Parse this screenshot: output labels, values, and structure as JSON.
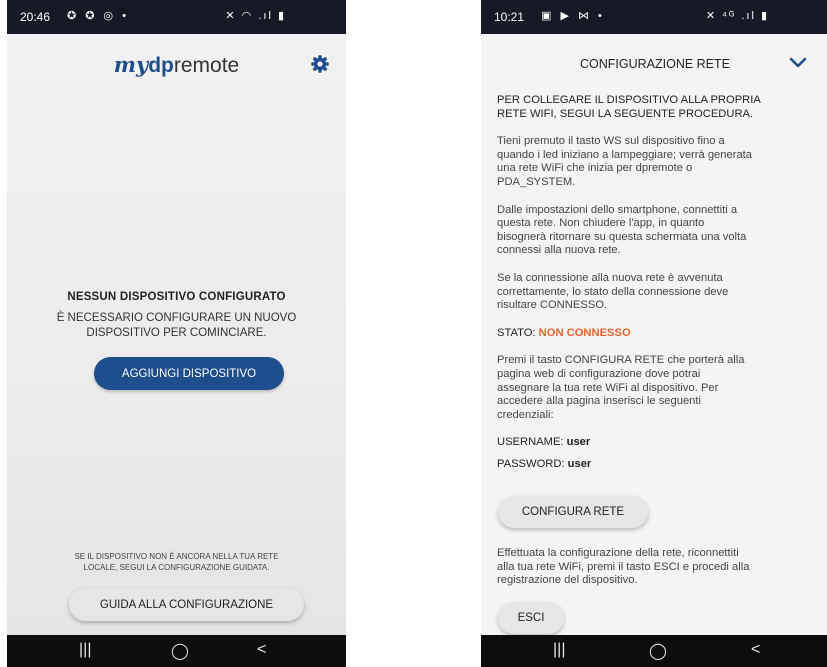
{
  "left_screen": {
    "status_bar": {
      "time": "20:46",
      "left_icons": "✪ ✪ ◎ •",
      "right_icons": "✕ ◠ .ıl ▮"
    },
    "app_logo": {
      "my": "my",
      "dp": "dp",
      "remote": "remote"
    },
    "empty_state": {
      "title": "NESSUN DISPOSITIVO CONFIGURATO",
      "line1": "È NECESSARIO CONFIGURARE UN NUOVO",
      "line2": "DISPOSITIVO PER COMINCIARE."
    },
    "add_device_button": "AGGIUNGI DISPOSITIVO",
    "hint": {
      "line1": "SE IL DISPOSITIVO NON È ANCORA NELLA TUA RETE",
      "line2": "LOCALE, SEGUI LA CONFIGURAZIONE GUIDATA."
    },
    "guide_button": "GUIDA ALLA CONFIGURAZIONE",
    "nav": {
      "recents": "|||",
      "home": "◯",
      "back": "<"
    }
  },
  "right_screen": {
    "status_bar": {
      "time": "10:21",
      "left_icons": "▣ ▶ ⋈ •",
      "right_icons": "✕ ⁴ᴳ .ıl ▮"
    },
    "header_title": "CONFIGURAZIONE RETE",
    "intro": {
      "line1": "PER COLLEGARE IL DISPOSITIVO ALLA PROPRIA",
      "line2": "RETE WIFI, SEGUI LA SEGUENTE PROCEDURA."
    },
    "para1": [
      "Tieni premuto il tasto WS sul dispositivo fino a",
      "quando i led iniziano a lampeggiare; verrà generata",
      "una rete WiFi che inizia per dpremote o",
      "PDA_SYSTEM."
    ],
    "para2": [
      "Dalle impostazioni dello smartphone, connettiti a",
      "questa rete. Non chiudere l'app, in quanto",
      "bisognerà ritornare su questa schermata una volta",
      "connessi alla nuova rete."
    ],
    "para3": [
      "Se la connessione alla nuova rete è avvenuta",
      "correttamente, lo stato della connessione deve",
      "risultare CONNESSO."
    ],
    "status": {
      "label": "STATO: ",
      "value": "NON CONNESSO",
      "value_color": "#e5632d"
    },
    "para4": [
      "Premi il tasto CONFIGURA RETE che porterà alla",
      "pagina web di configurazione dove potrai",
      "assegnare la tua rete WiFi al dispositivo. Per",
      "accedere alla pagina inserisci le seguenti",
      "credenziali:"
    ],
    "username": {
      "label": "USERNAME: ",
      "value": "user"
    },
    "password": {
      "label": "PASSWORD: ",
      "value": "user"
    },
    "configure_button": "CONFIGURA RETE",
    "para5": [
      "Effettuata la configurazione della rete, riconnettiti",
      "alla tua rete WiFi, premi il tasto ESCI e procedi alla",
      "registrazione del dispositivo."
    ],
    "exit_button": "ESCI",
    "nav": {
      "recents": "|||",
      "home": "◯",
      "back": "<"
    }
  },
  "colors": {
    "brand_blue": "#1f4e8c",
    "status_orange": "#e5632d",
    "status_bar": "#151a26"
  }
}
